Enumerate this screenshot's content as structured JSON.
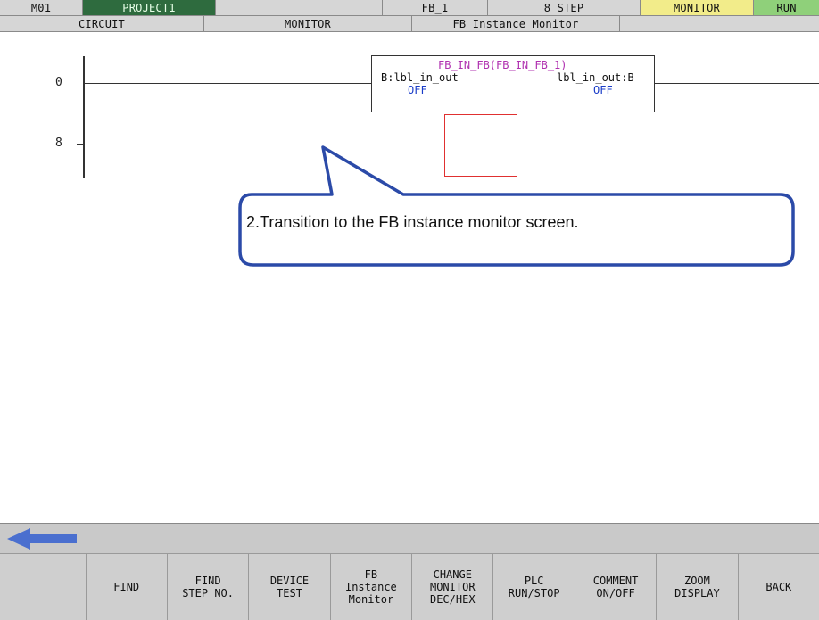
{
  "status_bar": {
    "program": "M01",
    "project": "PROJECT1",
    "blank1": "",
    "fb_name": "FB_1",
    "steps": "8 STEP",
    "mode": "MONITOR",
    "run_state": "RUN",
    "colors": {
      "project_bg": "#2e6b3e",
      "mode_bg": "#f2ec8a",
      "run_bg": "#8fd07a"
    }
  },
  "breadcrumb": {
    "circuit": "CIRCUIT",
    "monitor": "MONITOR",
    "fb_instance_monitor": "FB Instance Monitor",
    "blank": ""
  },
  "ladder": {
    "step_numbers": [
      "0",
      "8"
    ],
    "fb_block": {
      "title": "FB_IN_FB(FB_IN_FB_1)",
      "left_pin": "B:lbl_in_out",
      "right_pin": "lbl_in_out:B",
      "left_state": "OFF",
      "right_state": "OFF",
      "title_color": "#b030b0",
      "state_color": "#1a3cc8"
    }
  },
  "callout": {
    "text": "2.Transition to the FB instance monitor screen.",
    "border_color": "#2b4aa8"
  },
  "nav": {
    "back_arrow_icon": "left-arrow-icon"
  },
  "function_keys": [
    "",
    "FIND",
    "FIND\nSTEP NO.",
    "DEVICE\nTEST",
    "FB\nInstance\nMonitor",
    "CHANGE\nMONITOR\nDEC/HEX",
    "PLC\nRUN/STOP",
    "COMMENT\nON/OFF",
    "ZOOM\nDISPLAY",
    "BACK"
  ]
}
